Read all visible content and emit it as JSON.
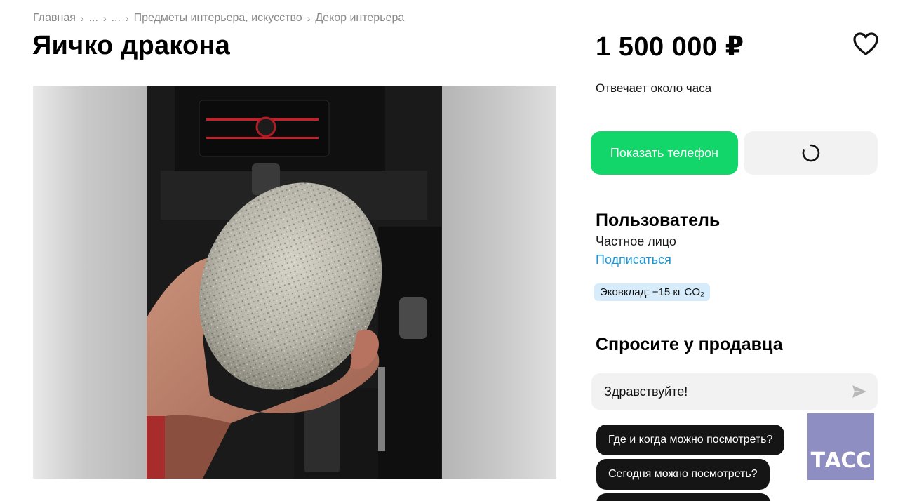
{
  "breadcrumb": {
    "items": [
      "Главная",
      "...",
      "...",
      "Предметы интерьера, искусство",
      "Декор интерьера"
    ],
    "separator": "›"
  },
  "listing": {
    "title": "Яичко дракона",
    "price": "1 500 000 ₽",
    "response_time": "Отвечает около часа"
  },
  "actions": {
    "show_phone": "Показать телефон"
  },
  "seller": {
    "name": "Пользователь",
    "type": "Частное лицо",
    "subscribe": "Подписаться",
    "eco_badge": "Эковклад: −15 кг CO₂"
  },
  "ask": {
    "title": "Спросите у продавца",
    "message_value": "Здравствуйте!",
    "quick_questions": [
      "Где и когда можно посмотреть?",
      "Сегодня можно посмотреть?",
      ""
    ]
  },
  "watermark": {
    "text": "ТАСС"
  },
  "icons": {
    "favorite": "heart-icon",
    "loading": "spinner-icon",
    "send": "send-arrow-icon"
  },
  "colors": {
    "primary_green": "#12d66a",
    "link_blue": "#1e95d4",
    "eco_badge_bg": "#d7ecfa",
    "chip_bg": "#151515",
    "tass_bg": "#8e8ec2"
  }
}
